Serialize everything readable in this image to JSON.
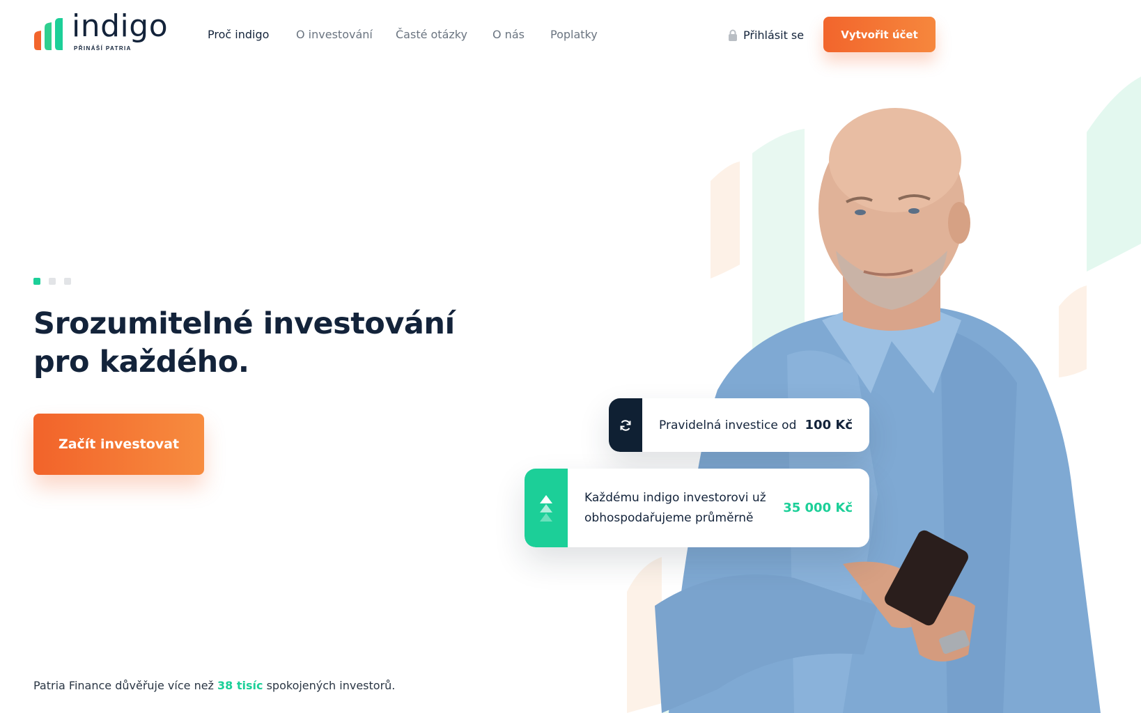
{
  "brand": {
    "name": "indigo",
    "tagline": "PŘINÁŠÍ PATRIA",
    "colors": {
      "navy": "#13233a",
      "green": "#1ccf98",
      "orange": "#f2652c",
      "orange_light": "#f78c3f"
    }
  },
  "nav": {
    "items": [
      {
        "label": "Proč indigo",
        "active": true
      },
      {
        "label": "O investování",
        "active": false
      },
      {
        "label": "Časté otázky",
        "active": false
      },
      {
        "label": "O nás",
        "active": false
      },
      {
        "label": "Poplatky",
        "active": false
      }
    ],
    "login": {
      "label": "Přihlásit se",
      "icon": "lock-icon"
    },
    "cta": {
      "label": "Vytvořit účet"
    }
  },
  "hero": {
    "slides": {
      "count": 3,
      "active_index": 0
    },
    "title_line1": "Srozumitelné investování",
    "title_line2": "pro každého.",
    "cta": {
      "label": "Začít investovat"
    },
    "cards": [
      {
        "icon": "refresh-icon",
        "text": "Pravidelná investice od",
        "value": "100 Kč"
      },
      {
        "icon": "growth-arrows-icon",
        "text_line1": "Každému indigo investorovi už",
        "text_line2": "obhospodařujeme průměrně",
        "value": "35 000 Kč"
      }
    ],
    "image": "man-with-smartphone"
  },
  "trust": {
    "before": "Patria Finance důvěřuje více než ",
    "highlight": "38 tisíc",
    "after": " spokojených investorů."
  }
}
